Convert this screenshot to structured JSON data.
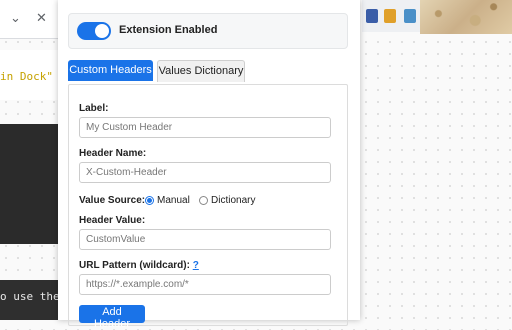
{
  "browser": {
    "chevron_icon": "chevron-down-icon",
    "close_icon": "close-icon",
    "code_line_top": "in Dock\"",
    "code_line_bottom": "o use the",
    "bookmarks_more": "»"
  },
  "popup": {
    "toggle": {
      "label": "Extension Enabled",
      "enabled": true
    },
    "tabs": [
      {
        "label": "Custom Headers",
        "active": true
      },
      {
        "label": "Values Dictionary",
        "active": false
      }
    ],
    "form": {
      "label_label": "Label:",
      "label_placeholder": "My Custom Header",
      "header_name_label": "Header Name:",
      "header_name_placeholder": "X-Custom-Header",
      "value_source_label": "Value Source:",
      "value_source_options": [
        {
          "label": "Manual",
          "checked": true
        },
        {
          "label": "Dictionary",
          "checked": false
        }
      ],
      "header_value_label": "Header Value:",
      "header_value_placeholder": "CustomValue",
      "url_pattern_label": "URL Pattern (wildcard):",
      "url_pattern_help": "?",
      "url_pattern_placeholder": "https://*.example.com/*",
      "add_button": "Add Header"
    }
  },
  "colors": {
    "accent": "#1a73e8"
  }
}
